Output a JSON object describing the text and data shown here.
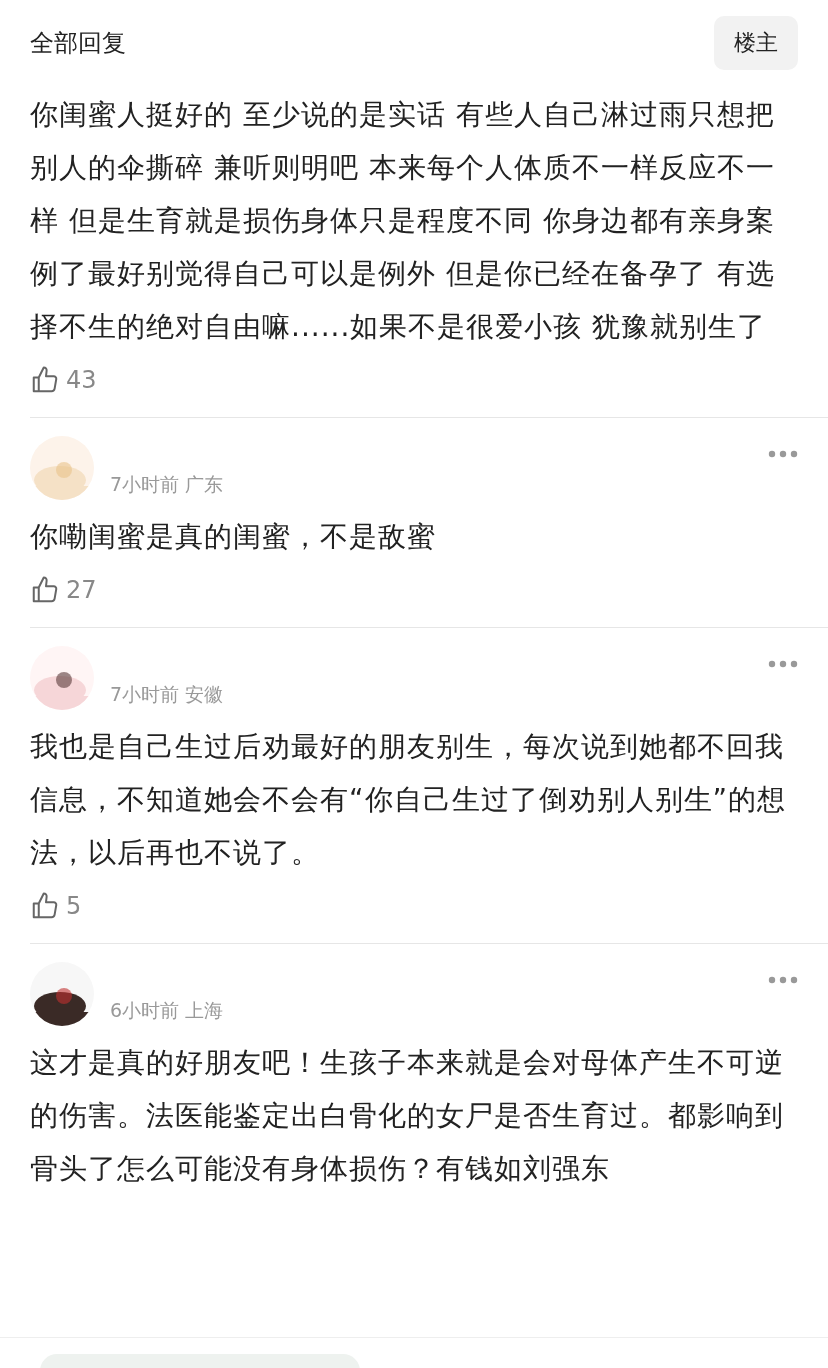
{
  "header": {
    "title": "全部回复",
    "op_button": "楼主"
  },
  "main_comment": {
    "text": "你闺蜜人挺好的 至少说的是实话 有些人自己淋过雨只想把别人的伞撕碎 兼听则明吧 本来每个人体质不一样反应不一样 但是生育就是损伤身体只是程度不同 你身边都有亲身案例了最好别觉得自己可以是例外 但是你已经在备孕了 有选择不生的绝对自由嘛......如果不是很爱小孩 犹豫就别生了",
    "likes": "43"
  },
  "replies": [
    {
      "meta": "7小时前 广东",
      "text": "你嘞闺蜜是真的闺蜜，不是敌蜜",
      "likes": "27"
    },
    {
      "meta": "7小时前 安徽",
      "text": "我也是自己生过后劝最好的朋友别生，每次说到她都不回我信息，不知道她会不会有“你自己生过了倒劝别人别生”的想法，以后再也不说了。",
      "likes": "5"
    },
    {
      "meta": "6小时前 上海",
      "text": "这才是真的好朋友吧！生孩子本来就是会对母体产生不可逆的伤害。法医能鉴定出白骨化的女尸是否生育过。都影响到骨头了怎么可能没有身体损伤？有钱如刘强东"
    }
  ]
}
